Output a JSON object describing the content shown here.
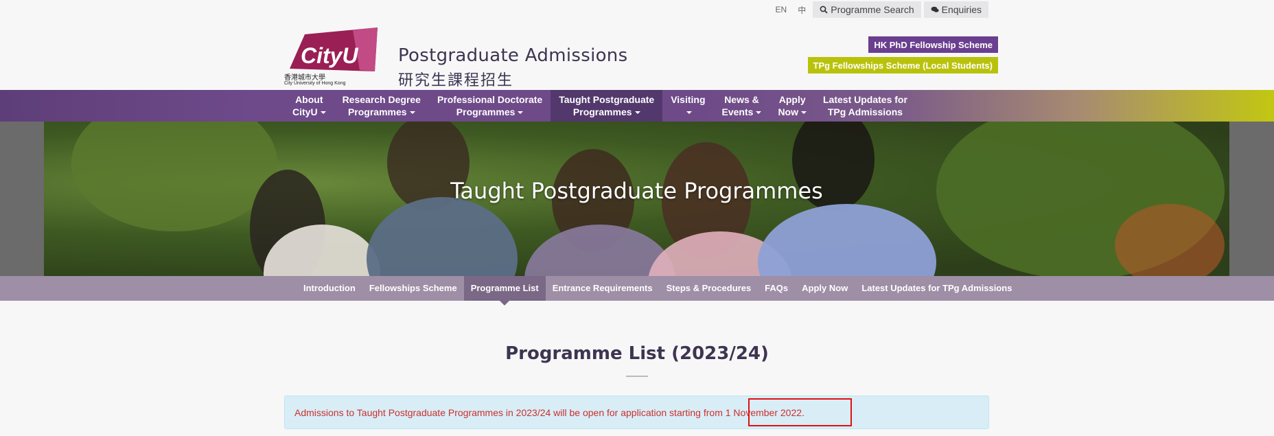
{
  "util": {
    "lang_en": "EN",
    "lang_zh": "中",
    "programme_search": "Programme Search",
    "enquiries": "Enquiries"
  },
  "header": {
    "logo_text": "CityU",
    "logo_zh": "香港城市大學",
    "logo_en": "City University of Hong Kong",
    "title": "Postgraduate Admissions",
    "title_zh": "研究生課程招生",
    "phd_fellowship": "HK PhD Fellowship Scheme",
    "tpg_fellowship": "TPg Fellowships Scheme (Local Students)"
  },
  "mainnav": {
    "items": [
      {
        "line1": "About",
        "line2": "CityU"
      },
      {
        "line1": "Research Degree",
        "line2": "Programmes"
      },
      {
        "line1": "Professional Doctorate",
        "line2": "Programmes"
      },
      {
        "line1": "Taught Postgraduate",
        "line2": "Programmes"
      },
      {
        "line1": "Visiting",
        "line2": ""
      },
      {
        "line1": "News &",
        "line2": "Events"
      },
      {
        "line1": "Apply",
        "line2": "Now"
      },
      {
        "line1": "Latest Updates for",
        "line2": "TPg Admissions"
      }
    ]
  },
  "banner": {
    "title": "Taught Postgraduate Programmes"
  },
  "subnav": {
    "items": [
      "Introduction",
      "Fellowships Scheme",
      "Programme List",
      "Entrance Requirements",
      "Steps & Procedures",
      "FAQs",
      "Apply Now",
      "Latest Updates for TPg Admissions"
    ]
  },
  "content": {
    "heading": "Programme List (2023/24)",
    "notice": "Admissions to Taught Postgraduate Programmes in 2023/24 will be open for application starting from 1 November 2022."
  },
  "colors": {
    "brand_purple": "#6e4a8a",
    "accent_lime": "#c2c712",
    "alert_bg": "#d9edf7",
    "alert_text": "#c9302c"
  }
}
